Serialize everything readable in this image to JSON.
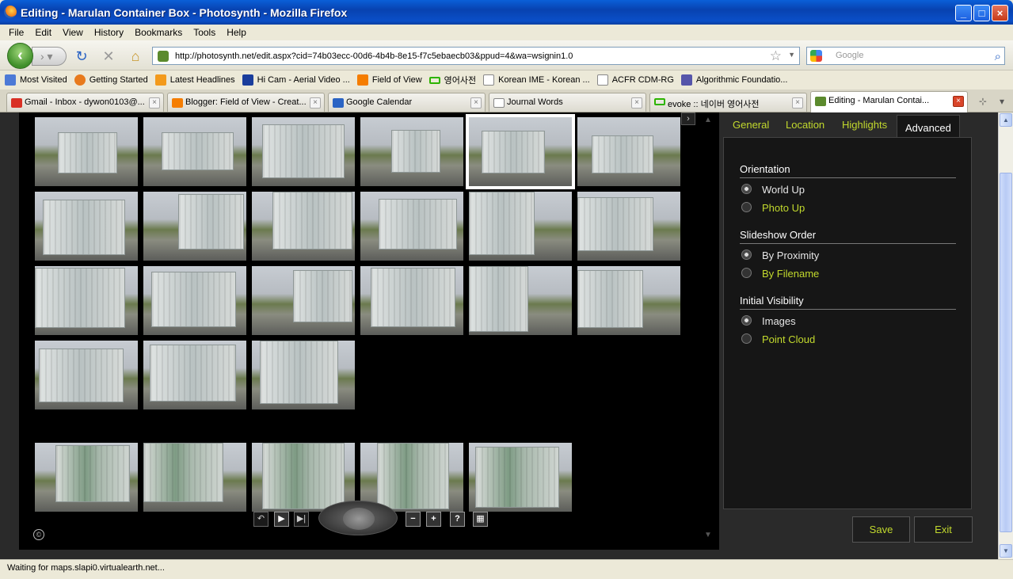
{
  "window": {
    "title": "Editing - Marulan Container Box - Photosynth - Mozilla Firefox"
  },
  "menu": [
    "File",
    "Edit",
    "View",
    "History",
    "Bookmarks",
    "Tools",
    "Help"
  ],
  "address": {
    "url": "http://photosynth.net/edit.aspx?cid=74b03ecc-00d6-4b4b-8e15-f7c5ebaecb03&ppud=4&wa=wsignin1.0"
  },
  "search": {
    "placeholder": "Google"
  },
  "bookmarks": [
    {
      "label": "Most Visited",
      "icon": "most-visited-icon",
      "color": "#4d7ad6"
    },
    {
      "label": "Getting Started",
      "icon": "firefox-icon",
      "color": "#e87a1c"
    },
    {
      "label": "Latest Headlines",
      "icon": "rss-icon",
      "color": "#f39a1b"
    },
    {
      "label": "Hi Cam - Aerial Video ...",
      "icon": "hi-icon",
      "color": "#1a3d9c"
    },
    {
      "label": "Field of View",
      "icon": "blogger-icon",
      "color": "#f57d00"
    },
    {
      "label": "영어사전",
      "icon": "naver-icon",
      "color": "#2db400"
    },
    {
      "label": "Korean IME - Korean ...",
      "icon": "page-icon",
      "color": "#ffffff"
    },
    {
      "label": "ACFR CDM-RG",
      "icon": "page-icon",
      "color": "#ffffff"
    },
    {
      "label": "Algorithmic Foundatio...",
      "icon": "mit-icon",
      "color": "#5555aa"
    }
  ],
  "tabs": [
    {
      "label": "Gmail - Inbox - dywon0103@...",
      "icon": "gmail-icon",
      "color": "#d93025"
    },
    {
      "label": "Blogger: Field of View - Creat...",
      "icon": "blogger-icon",
      "color": "#f57d00"
    },
    {
      "label": "Google Calendar",
      "icon": "calendar-icon",
      "color": "#2a63c4"
    },
    {
      "label": "Journal Words",
      "icon": "page-icon",
      "color": "#ffffff"
    },
    {
      "label": "evoke :: 네이버 영어사전",
      "icon": "naver-icon",
      "color": "#2db400"
    },
    {
      "label": "Editing - Marulan Contai...",
      "icon": "photosynth-icon",
      "color": "#5b8a2d"
    }
  ],
  "panel": {
    "tabs": [
      "General",
      "Location",
      "Highlights",
      "Advanced"
    ],
    "active_tab": "Advanced",
    "sections": [
      {
        "title": "Orientation",
        "options": [
          {
            "label": "World Up",
            "selected": true
          },
          {
            "label": "Photo Up",
            "selected": false
          }
        ]
      },
      {
        "title": "Slideshow Order",
        "options": [
          {
            "label": "By Proximity",
            "selected": true
          },
          {
            "label": "By Filename",
            "selected": false
          }
        ]
      },
      {
        "title": "Initial Visibility",
        "options": [
          {
            "label": "Images",
            "selected": true
          },
          {
            "label": "Point Cloud",
            "selected": false
          }
        ]
      }
    ],
    "save_label": "Save",
    "exit_label": "Exit"
  },
  "viewer": {
    "grid_rows": [
      6,
      6,
      6,
      3
    ],
    "bottom_row": 5,
    "selected_thumb": 5,
    "controls": {
      "zoom_out": "−",
      "zoom_in": "+",
      "help": "?"
    }
  },
  "status": {
    "text": "Waiting for maps.slapi0.virtualearth.net..."
  }
}
